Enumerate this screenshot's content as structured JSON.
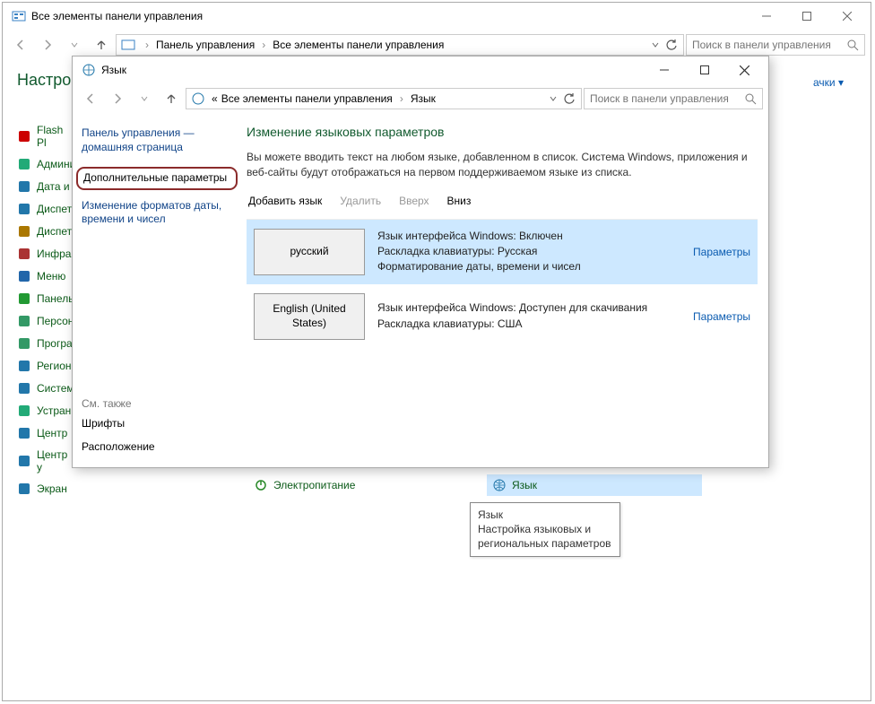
{
  "bg": {
    "title": "Все элементы панели управления",
    "crumb1": "Панель управления",
    "crumb2": "Все элементы панели управления",
    "search_ph": "Поиск в панели управления",
    "heading": "Настрой",
    "view_partial": "ачки",
    "items": [
      "Flash Pl",
      "Админи",
      "Дата и",
      "Диспет",
      "Диспет",
      "Инфра",
      "Меню",
      "Панель",
      "Персон",
      "Програ",
      "Регион",
      "Систем",
      "Устран",
      "Центр",
      "Центр у",
      "Экран"
    ],
    "mid_items": [
      "Электропитание"
    ],
    "right_items": [
      "Язык"
    ]
  },
  "lang": {
    "title": "Язык",
    "crumb1": "Все элементы панели управления",
    "crumb2": "Язык",
    "search_ph": "Поиск в панели управления",
    "nav_home": "Панель управления — домашняя страница",
    "nav_advanced": "Дополнительные параметры",
    "nav_formats": "Изменение форматов даты, времени и чисел",
    "also_hdr": "См. также",
    "also_fonts": "Шрифты",
    "also_loc": "Расположение",
    "heading": "Изменение языковых параметров",
    "desc": "Вы можете вводить текст на любом языке, добавленном в список. Система Windows, приложения и веб-сайты будут отображаться на первом поддерживаемом языке из списка.",
    "tb_add": "Добавить язык",
    "tb_remove": "Удалить",
    "tb_up": "Вверх",
    "tb_down": "Вниз",
    "langs": [
      {
        "name": "русский",
        "line1": "Язык интерфейса Windows: Включен",
        "line2": "Раскладка клавиатуры: Русская",
        "line3": "Форматирование даты, времени и чисел",
        "link": "Параметры"
      },
      {
        "name": "English (United States)",
        "line1": "Язык интерфейса Windows: Доступен для скачивания",
        "line2": "Раскладка клавиатуры: США",
        "line3": "",
        "link": "Параметры"
      }
    ]
  },
  "tooltip": {
    "title": "Язык",
    "line1": "Настройка языковых и",
    "line2": "региональных параметров"
  }
}
